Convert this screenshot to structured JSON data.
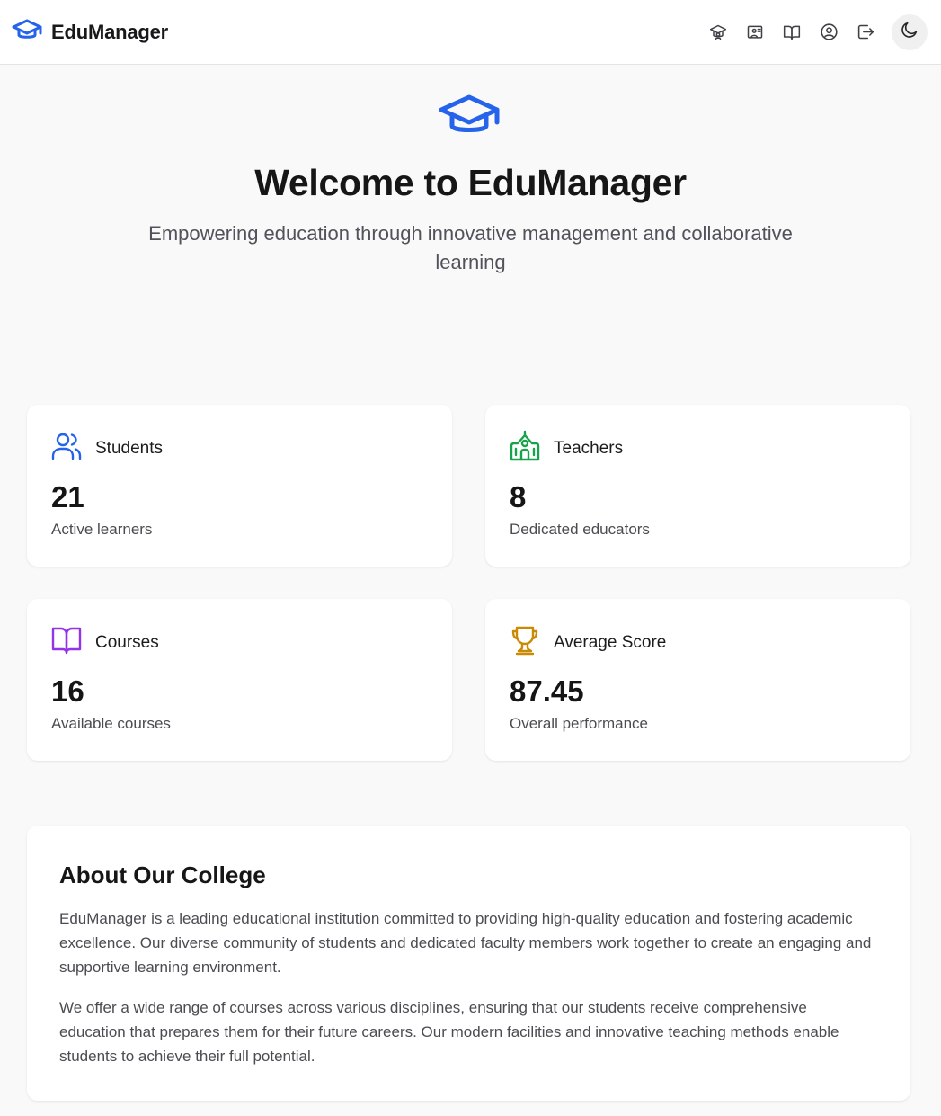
{
  "app": {
    "name": "EduManager",
    "accent_color": "#2563eb"
  },
  "nav": {
    "icons": [
      "graduation-cap-icon",
      "presentation-icon",
      "book-open-icon",
      "user-circle-icon",
      "log-out-icon"
    ],
    "theme_toggle": "moon-icon"
  },
  "hero": {
    "title": "Welcome to EduManager",
    "subtitle": "Empowering education through innovative management and collaborative learning"
  },
  "stats": [
    {
      "label": "Students",
      "value": "21",
      "description": "Active learners",
      "icon": "users-icon",
      "color": "#2563eb"
    },
    {
      "label": "Teachers",
      "value": "8",
      "description": "Dedicated educators",
      "icon": "school-icon",
      "color": "#16a34a"
    },
    {
      "label": "Courses",
      "value": "16",
      "description": "Available courses",
      "icon": "book-open-icon",
      "color": "#9333ea"
    },
    {
      "label": "Average Score",
      "value": "87.45",
      "description": "Overall performance",
      "icon": "trophy-icon",
      "color": "#ca8a04"
    }
  ],
  "about": {
    "title": "About Our College",
    "paragraphs": [
      "EduManager is a leading educational institution committed to providing high-quality education and fostering academic excellence. Our diverse community of students and dedicated faculty members work together to create an engaging and supportive learning environment.",
      "We offer a wide range of courses across various disciplines, ensuring that our students receive comprehensive education that prepares them for their future careers. Our modern facilities and innovative teaching methods enable students to achieve their full potential."
    ]
  }
}
